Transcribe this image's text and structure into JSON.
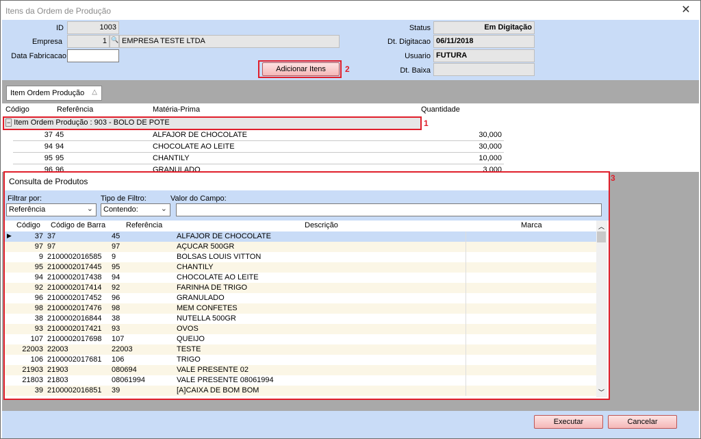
{
  "window": {
    "title": "Itens da Ordem de Produção",
    "close_glyph": "✕"
  },
  "header": {
    "id_label": "ID",
    "id_value": "1003",
    "empresa_label": "Empresa",
    "empresa_code": "1",
    "empresa_name": "EMPRESA TESTE LTDA",
    "data_fab_label": "Data Fabricacao",
    "data_fab_value": "",
    "status_label": "Status",
    "status_value": "Em Digitação",
    "dt_digitacao_label": "Dt. Digitacao",
    "dt_digitacao_value": "06/11/2018",
    "usuario_label": "Usuario",
    "usuario_value": "FUTURA",
    "dt_baixa_label": "Dt. Baixa",
    "dt_baixa_value": "",
    "adicionar_label": "Adicionar Itens"
  },
  "annotations": {
    "n1": "1",
    "n2": "2",
    "n3": "3",
    "accent": "#e01e2a"
  },
  "tab": {
    "label": "Item Ordem Produção",
    "icon": "sort-triangle-icon"
  },
  "items_grid": {
    "columns": [
      "Código",
      "Referência",
      "Matéria-Prima",
      "Quantidade"
    ],
    "group": "Item Ordem Produção : 903 - BOLO DE POTE",
    "rows": [
      {
        "codigo": "37",
        "ref": "45",
        "mp": "ALFAJOR DE CHOCOLATE",
        "qtd": "30,000"
      },
      {
        "codigo": "94",
        "ref": "94",
        "mp": "CHOCOLATE AO LEITE",
        "qtd": "30,000"
      },
      {
        "codigo": "95",
        "ref": "95",
        "mp": "CHANTILY",
        "qtd": "10,000"
      },
      {
        "codigo": "96",
        "ref": "96",
        "mp": "GRANULADO",
        "qtd": "3,000"
      }
    ]
  },
  "consulta": {
    "title": "Consulta de Produtos",
    "filtrar_label": "Filtrar por:",
    "filtrar_value": "Referência",
    "tipo_label": "Tipo de Filtro:",
    "tipo_value": "Contendo:",
    "valor_label": "Valor do Campo:",
    "valor_value": "",
    "columns": [
      "Código",
      "Código de Barra",
      "Referência",
      "Descrição",
      "Marca"
    ],
    "rows": [
      {
        "codigo": "37",
        "barra": "37",
        "ref": "45",
        "desc": "ALFAJOR DE CHOCOLATE"
      },
      {
        "codigo": "97",
        "barra": "97",
        "ref": "97",
        "desc": "AÇUCAR 500GR"
      },
      {
        "codigo": "9",
        "barra": "2100002016585",
        "ref": "9",
        "desc": "BOLSAS LOUIS VITTON"
      },
      {
        "codigo": "95",
        "barra": "2100002017445",
        "ref": "95",
        "desc": "CHANTILY"
      },
      {
        "codigo": "94",
        "barra": "2100002017438",
        "ref": "94",
        "desc": "CHOCOLATE AO LEITE"
      },
      {
        "codigo": "92",
        "barra": "2100002017414",
        "ref": "92",
        "desc": "FARINHA DE TRIGO"
      },
      {
        "codigo": "96",
        "barra": "2100002017452",
        "ref": "96",
        "desc": "GRANULADO"
      },
      {
        "codigo": "98",
        "barra": "2100002017476",
        "ref": "98",
        "desc": "MEM CONFETES"
      },
      {
        "codigo": "38",
        "barra": "2100002016844",
        "ref": "38",
        "desc": "NUTELLA 500GR"
      },
      {
        "codigo": "93",
        "barra": "2100002017421",
        "ref": "93",
        "desc": "OVOS"
      },
      {
        "codigo": "107",
        "barra": "2100002017698",
        "ref": "107",
        "desc": "QUEIJO"
      },
      {
        "codigo": "22003",
        "barra": "22003",
        "ref": "22003",
        "desc": "TESTE"
      },
      {
        "codigo": "106",
        "barra": "2100002017681",
        "ref": "106",
        "desc": "TRIGO"
      },
      {
        "codigo": "21903",
        "barra": "21903",
        "ref": "080694",
        "desc": "VALE PRESENTE 02"
      },
      {
        "codigo": "21803",
        "barra": "21803",
        "ref": " 08061994",
        "desc": "VALE PRESENTE 08061994"
      },
      {
        "codigo": "39",
        "barra": "2100002016851",
        "ref": "39",
        "desc": "[A]CAIXA DE BOM BOM"
      }
    ]
  },
  "footer": {
    "executar_label": "Executar",
    "cancelar_label": "Cancelar"
  }
}
